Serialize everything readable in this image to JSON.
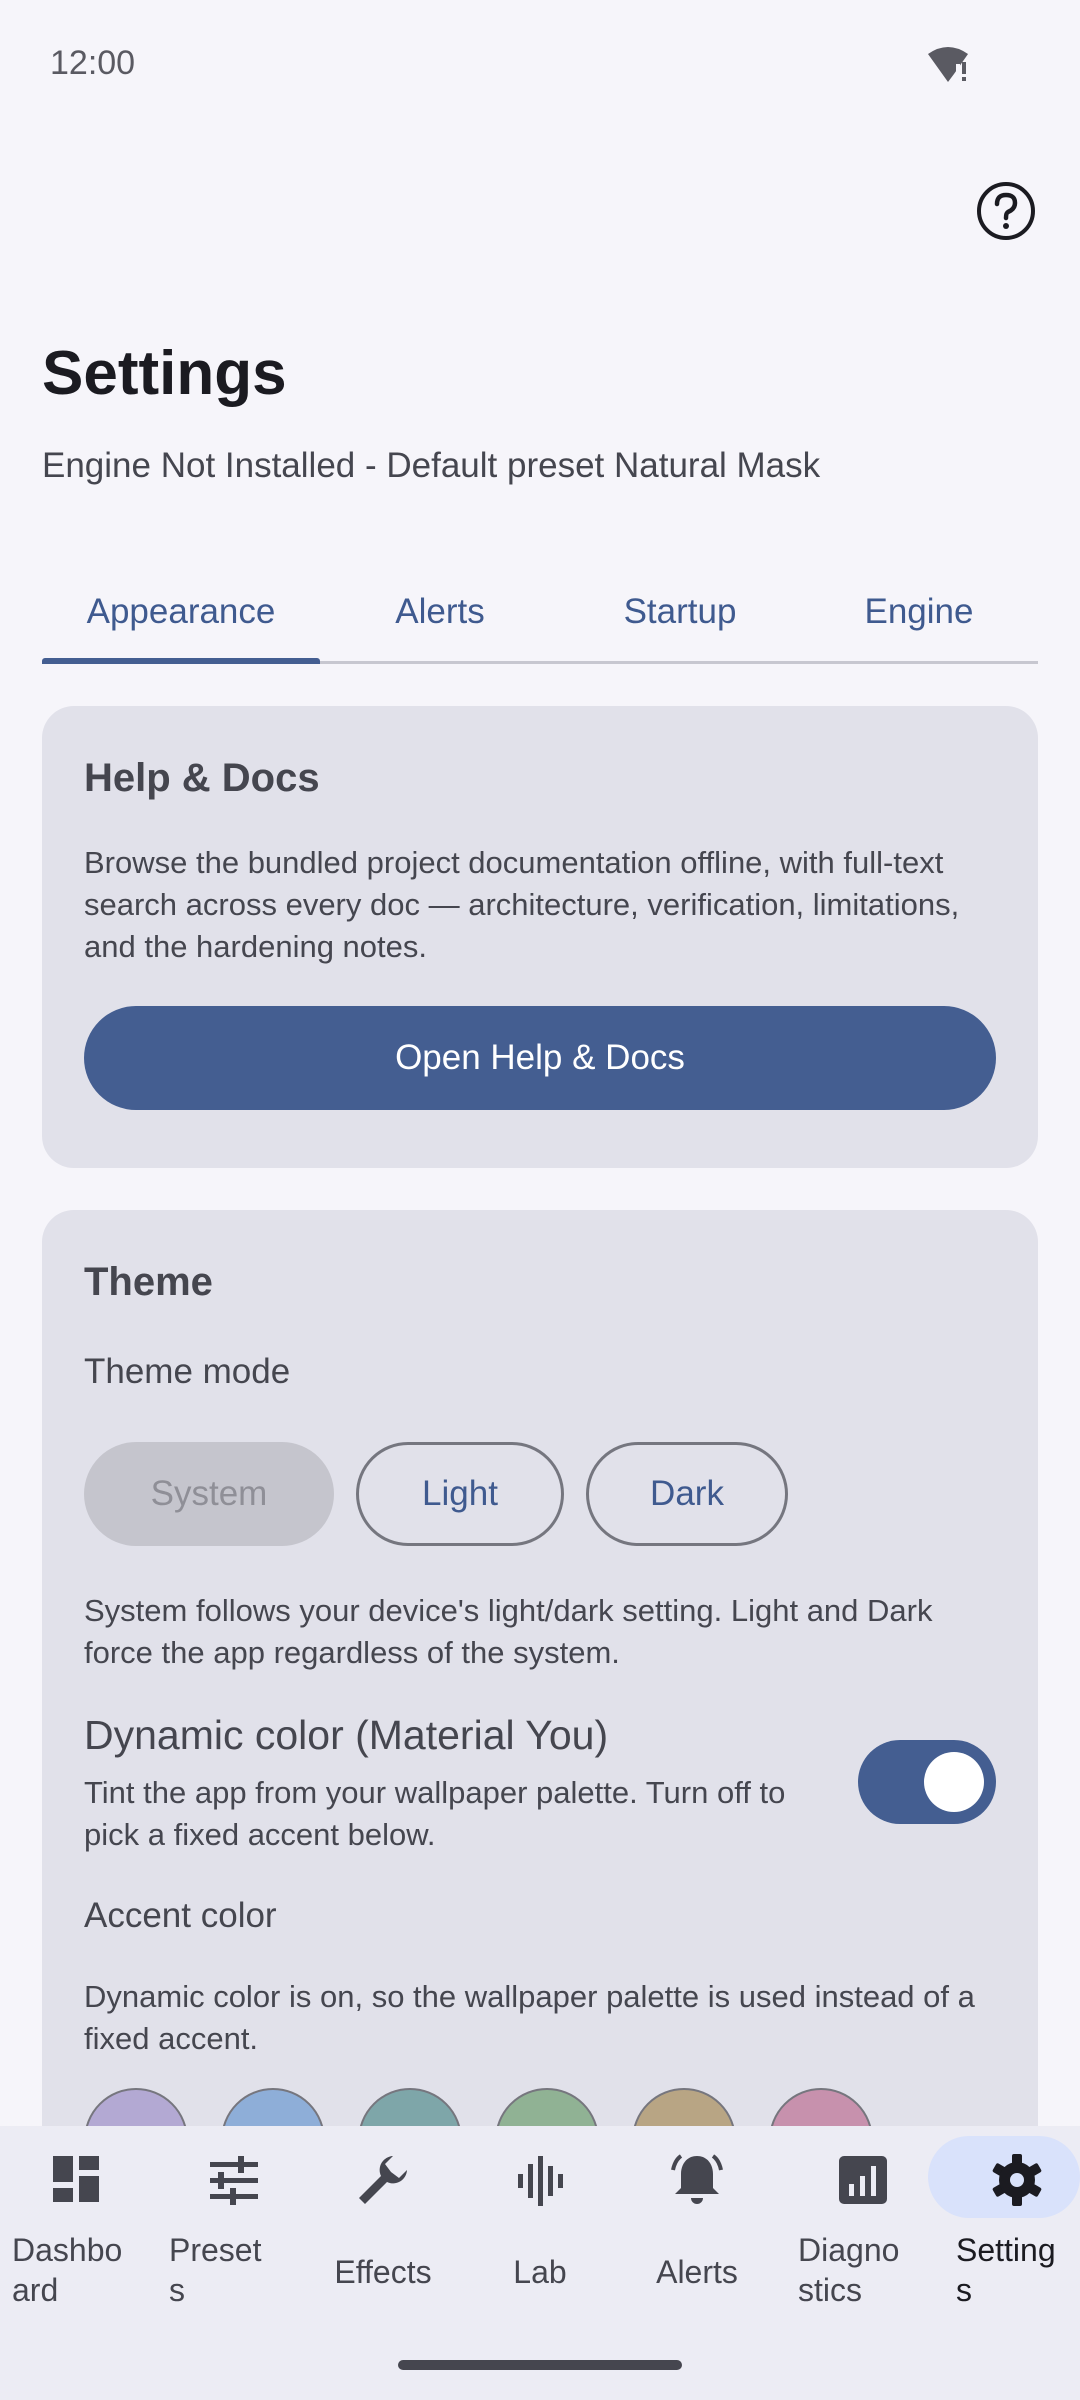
{
  "status_bar": {
    "time": "12:00",
    "wifi_icon": "wifi-alert-icon"
  },
  "header": {
    "help_icon": "help-circle-icon",
    "title": "Settings",
    "subtitle": "Engine Not Installed - Default preset Natural Mask"
  },
  "tabs": [
    {
      "label": "Appearance",
      "selected": true
    },
    {
      "label": "Alerts",
      "selected": false
    },
    {
      "label": "Startup",
      "selected": false
    },
    {
      "label": "Engine",
      "selected": false
    }
  ],
  "help_card": {
    "title": "Help & Docs",
    "description": "Browse the bundled project documentation offline, with full-text search across every doc — architecture, verification, limitations, and the hardening notes.",
    "button_label": "Open Help & Docs"
  },
  "theme_card": {
    "title": "Theme",
    "mode_label": "Theme mode",
    "modes": [
      {
        "label": "System",
        "selected": true
      },
      {
        "label": "Light",
        "selected": false
      },
      {
        "label": "Dark",
        "selected": false
      }
    ],
    "mode_description": "System follows your device's light/dark setting. Light and Dark force the app regardless of the system.",
    "dynamic_title": "Dynamic color (Material You)",
    "dynamic_description": "Tint the app from your wallpaper palette. Turn off to pick a fixed accent below.",
    "dynamic_enabled": true,
    "accent_label": "Accent color",
    "accent_description": "Dynamic color is on, so the wallpaper palette is used instead of a fixed accent.",
    "accent_swatches": [
      "#b3a9d3",
      "#8eaed8",
      "#7ea6a9",
      "#90b294",
      "#b8a584",
      "#c791ad"
    ]
  },
  "bottom_nav": [
    {
      "label": "Dashbo\nard",
      "icon": "dashboard-icon",
      "selected": false
    },
    {
      "label": "Preset\ns",
      "icon": "sliders-icon",
      "selected": false
    },
    {
      "label": "Effects",
      "icon": "wrench-icon",
      "selected": false
    },
    {
      "label": "Lab",
      "icon": "waveform-icon",
      "selected": false
    },
    {
      "label": "Alerts",
      "icon": "bell-icon",
      "selected": false
    },
    {
      "label": "Diagno\nstics",
      "icon": "bar-chart-icon",
      "selected": false
    },
    {
      "label": "Setting\ns",
      "icon": "gear-icon",
      "selected": true
    }
  ],
  "colors": {
    "primary": "#445e91",
    "surface": "#f6f5fa",
    "card": "#e1e1ea",
    "nav_background": "#ececf4",
    "nav_selected_pill": "#d9e2fb"
  }
}
